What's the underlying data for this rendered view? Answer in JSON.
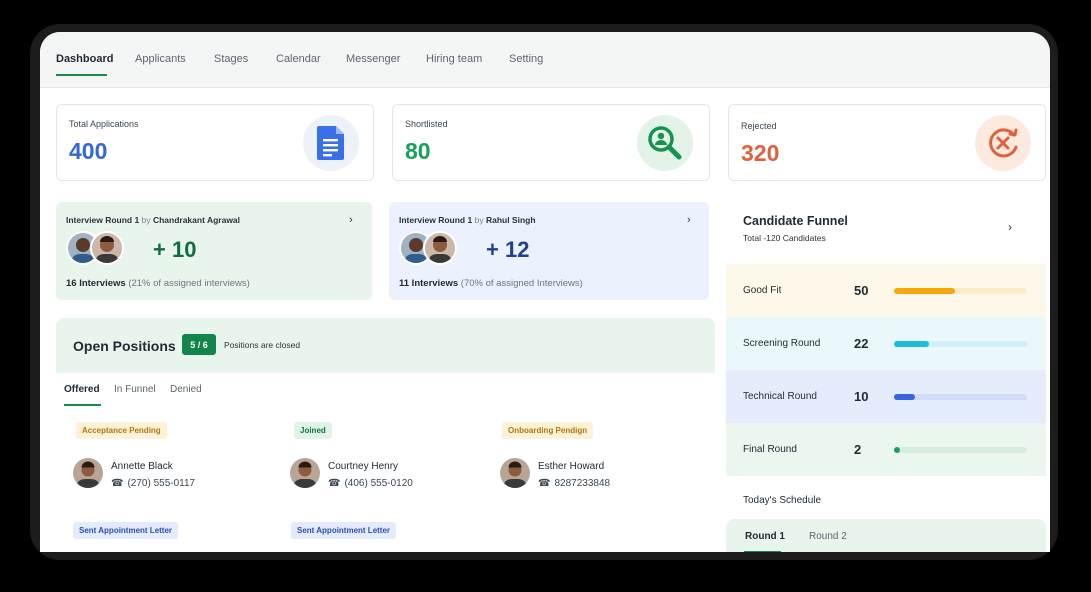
{
  "nav": {
    "items": [
      {
        "label": "Dashboard",
        "active": true
      },
      {
        "label": "Applicants"
      },
      {
        "label": "Stages"
      },
      {
        "label": "Calendar"
      },
      {
        "label": "Messenger"
      },
      {
        "label": "Hiring team"
      },
      {
        "label": "Setting"
      }
    ]
  },
  "stats": [
    {
      "label": "Total Applications",
      "value": "400",
      "color": "#3567d6",
      "icon": "document-icon"
    },
    {
      "label": "Shortlisted",
      "value": "80",
      "color": "#16a15a",
      "icon": "candidate-search-icon"
    },
    {
      "label": "Rejected",
      "value": "320",
      "color": "#e2603b",
      "icon": "reject-icon"
    }
  ],
  "interviews": [
    {
      "round": "Interview Round 1",
      "by": "by",
      "interviewer": "Chandrakant Agrawal",
      "count": "+ 10",
      "interviews": "16 Interviews",
      "detail": "(21% of assigned interviews)",
      "bg": "#e8f5ec",
      "color": "#136b3e"
    },
    {
      "round": "Interview Round 1",
      "by": "by",
      "interviewer": "Rahul Singh",
      "count": "+ 12",
      "interviews": "11 Interviews",
      "detail": "(70% of assigned Interviews)",
      "bg": "#ebf1fd",
      "color": "#1f3f93"
    }
  ],
  "positions": {
    "title": "Open Positions",
    "badge": "5 / 6",
    "note": "Positions are closed",
    "tabs": [
      "Offered",
      "In Funnel",
      "Denied"
    ],
    "candidates": [
      {
        "tag": "Acceptance Pending",
        "name": "Annette Black",
        "phone": "(270) 555-0117"
      },
      {
        "tag": "Joined",
        "name": "Courtney Henry",
        "phone": "(406) 555-0120"
      },
      {
        "tag": "Onboarding Pendign",
        "name": "Esther Howard",
        "phone": "8287233848"
      }
    ],
    "next_tags": [
      "Sent Appointment Letter",
      "Sent Appointment Letter"
    ]
  },
  "funnel": {
    "title": "Candidate Funnel",
    "subtitle": "Total -120 Candidates",
    "rows": [
      {
        "label": "Good Fit",
        "value": "50",
        "fraction": 0.46,
        "color": "#f5a80c",
        "bg": "#fef8ea",
        "track": "#fbeccc"
      },
      {
        "label": "Screening Round",
        "value": "22",
        "fraction": 0.26,
        "color": "#1fbcd9",
        "bg": "#eaf8fb",
        "track": "#d2f0f6"
      },
      {
        "label": "Technical Round",
        "value": "10",
        "fraction": 0.16,
        "color": "#3a64dd",
        "bg": "#e5ecfc",
        "track": "#d0dcf8"
      },
      {
        "label": "Final Round",
        "value": "2",
        "fraction": 0.04,
        "color": "#16a15a",
        "bg": "#eaf6ee",
        "track": "#d5eedd"
      }
    ],
    "schedule": "Today's Schedule",
    "rounds": [
      "Round 1",
      "Round 2"
    ]
  }
}
